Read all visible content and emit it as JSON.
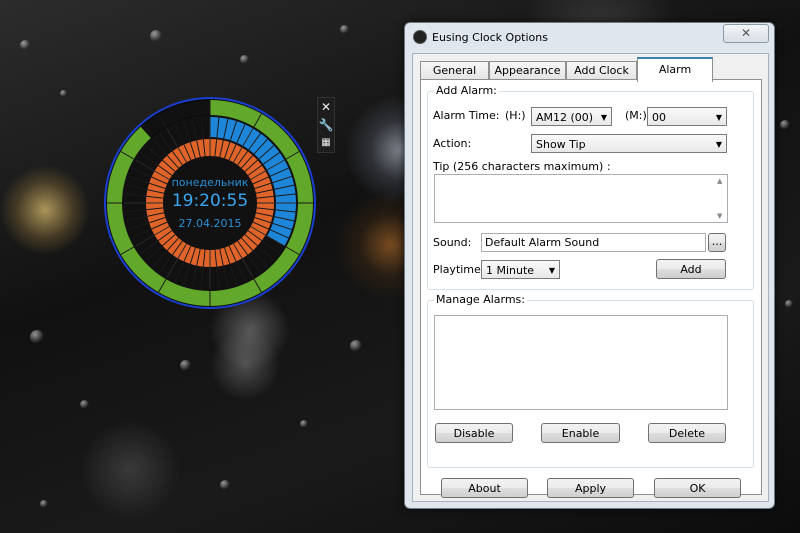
{
  "clock": {
    "day": "понедельник",
    "time": "19:20:55",
    "date": "27.04.2015",
    "colors": {
      "outer": "#62a82a",
      "hours": "#e0642a",
      "seconds": "#1e86d8",
      "ring": "#1a3fd0"
    }
  },
  "clock_tools": {
    "close": "✕",
    "settings": "🔧",
    "grid": "▦"
  },
  "dialog": {
    "title": "Eusing Clock Options",
    "close_label": "✕",
    "tabs": [
      {
        "label": "General"
      },
      {
        "label": "Appearance"
      },
      {
        "label": "Add Clock"
      },
      {
        "label": "Alarm"
      }
    ],
    "add_alarm": {
      "group_title": "Add Alarm:",
      "time_label": "Alarm Time:",
      "hour_label": "(H:)",
      "hour_value": "AM12 (00)",
      "minute_label": "(M:)",
      "minute_value": "00",
      "action_label": "Action:",
      "action_value": "Show Tip",
      "tip_label": "Tip (256 characters maximum) :",
      "tip_value": "",
      "sound_label": "Sound:",
      "sound_value": "Default Alarm Sound",
      "browse_label": "...",
      "playtime_label": "Playtime:",
      "playtime_value": "1 Minute",
      "add_button": "Add"
    },
    "manage": {
      "group_title": "Manage Alarms:",
      "disable": "Disable",
      "enable": "Enable",
      "delete": "Delete"
    },
    "footer": {
      "about": "About",
      "apply": "Apply",
      "ok": "OK"
    }
  }
}
